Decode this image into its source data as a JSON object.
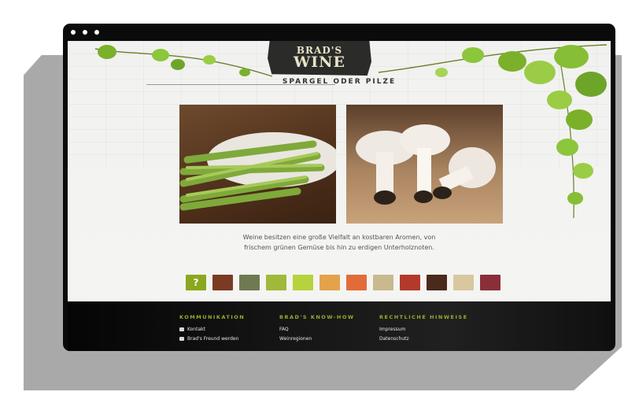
{
  "site": {
    "logo_line1": "BRAD'S",
    "logo_line2": "WINE",
    "page_title": "SPARGEL ODER PILZE",
    "description_line1": "Weine besitzen eine große Vielfalt an kostbaren Aromen, von",
    "description_line2": "frischem grünen Gemüse bis hin zu erdigen Unterholznoten."
  },
  "thumbnails": [
    {
      "label": "?",
      "color": "#8aa81e"
    },
    {
      "color": "#7a3b22",
      "icon": "steak-thumbnail"
    },
    {
      "color": "#6f7a52",
      "icon": "landscape-thumbnail"
    },
    {
      "color": "#9fba3a",
      "icon": "grapes-thumbnail"
    },
    {
      "color": "#b6d23c",
      "icon": "lime-thumbnail"
    },
    {
      "color": "#e4a24a",
      "icon": "orange-thumbnail"
    },
    {
      "color": "#e36b3a",
      "icon": "fruit-thumbnail"
    },
    {
      "color": "#c9b98e",
      "icon": "bread-thumbnail"
    },
    {
      "color": "#b33a2a",
      "icon": "pepper-thumbnail"
    },
    {
      "color": "#4a2a1c",
      "icon": "chocolate-thumbnail"
    },
    {
      "color": "#d9c7a0",
      "icon": "cheese-thumbnail"
    },
    {
      "color": "#8a2f3a",
      "icon": "berry-thumbnail"
    }
  ],
  "footer": {
    "col1": {
      "heading": "KOMMUNIKATION",
      "links": [
        "Kontakt",
        "Brad's Freund werden"
      ]
    },
    "col2": {
      "heading": "BRAD'S KNOW-HOW",
      "links": [
        "FAQ",
        "Weinregionen"
      ]
    },
    "col3": {
      "heading": "RECHTLICHE HINWEISE",
      "links": [
        "Impressum",
        "Datenschutz"
      ]
    }
  },
  "colors": {
    "accent": "#9aac2a",
    "frame": "#0b0b0b"
  }
}
